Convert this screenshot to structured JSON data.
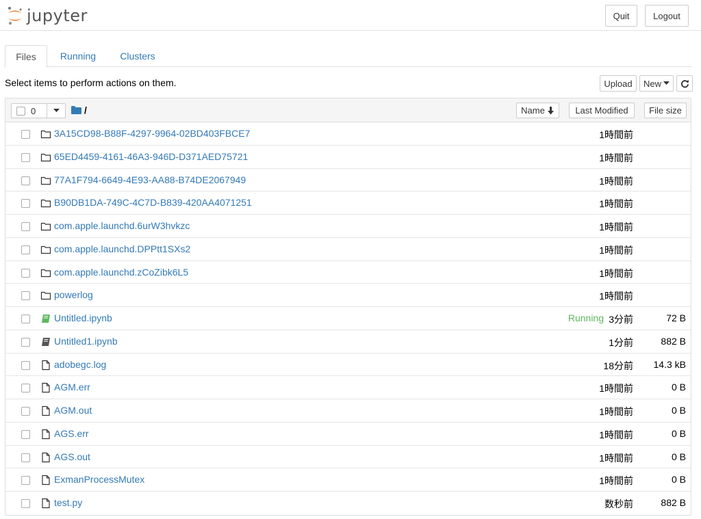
{
  "header": {
    "logo_text": "jupyter",
    "quit_label": "Quit",
    "logout_label": "Logout"
  },
  "tabs": [
    {
      "label": "Files",
      "active": true
    },
    {
      "label": "Running",
      "active": false
    },
    {
      "label": "Clusters",
      "active": false
    }
  ],
  "toolbar": {
    "hint": "Select items to perform actions on them.",
    "upload_label": "Upload",
    "new_label": "New",
    "refresh_icon": "refresh-icon"
  },
  "list_header": {
    "selected_count": "0",
    "breadcrumb": "/",
    "sort_name_label": "Name",
    "sort_modified_label": "Last Modified",
    "sort_size_label": "File size"
  },
  "colors": {
    "link": "#337ab7",
    "running": "#5cb85c",
    "notebook_running": "#5cb85c",
    "folder_icon": "#337ab7",
    "logo_orange": "#f37726"
  },
  "files": [
    {
      "type": "folder",
      "name": "3A15CD98-B88F-4297-9964-02BD403FBCE7",
      "status": "",
      "modified": "1時間前",
      "size": ""
    },
    {
      "type": "folder",
      "name": "65ED4459-4161-46A3-946D-D371AED75721",
      "status": "",
      "modified": "1時間前",
      "size": ""
    },
    {
      "type": "folder",
      "name": "77A1F794-6649-4E93-AA88-B74DE2067949",
      "status": "",
      "modified": "1時間前",
      "size": ""
    },
    {
      "type": "folder",
      "name": "B90DB1DA-749C-4C7D-B839-420AA4071251",
      "status": "",
      "modified": "1時間前",
      "size": ""
    },
    {
      "type": "folder",
      "name": "com.apple.launchd.6urW3hvkzc",
      "status": "",
      "modified": "1時間前",
      "size": ""
    },
    {
      "type": "folder",
      "name": "com.apple.launchd.DPPtt1SXs2",
      "status": "",
      "modified": "1時間前",
      "size": ""
    },
    {
      "type": "folder",
      "name": "com.apple.launchd.zCoZibk6L5",
      "status": "",
      "modified": "1時間前",
      "size": ""
    },
    {
      "type": "folder",
      "name": "powerlog",
      "status": "",
      "modified": "1時間前",
      "size": ""
    },
    {
      "type": "notebook-running",
      "name": "Untitled.ipynb",
      "status": "Running",
      "modified": "3分前",
      "size": "72 B"
    },
    {
      "type": "notebook",
      "name": "Untitled1.ipynb",
      "status": "",
      "modified": "1分前",
      "size": "882 B"
    },
    {
      "type": "file",
      "name": "adobegc.log",
      "status": "",
      "modified": "18分前",
      "size": "14.3 kB"
    },
    {
      "type": "file",
      "name": "AGM.err",
      "status": "",
      "modified": "1時間前",
      "size": "0 B"
    },
    {
      "type": "file",
      "name": "AGM.out",
      "status": "",
      "modified": "1時間前",
      "size": "0 B"
    },
    {
      "type": "file",
      "name": "AGS.err",
      "status": "",
      "modified": "1時間前",
      "size": "0 B"
    },
    {
      "type": "file",
      "name": "AGS.out",
      "status": "",
      "modified": "1時間前",
      "size": "0 B"
    },
    {
      "type": "file",
      "name": "ExmanProcessMutex",
      "status": "",
      "modified": "1時間前",
      "size": "0 B"
    },
    {
      "type": "file",
      "name": "test.py",
      "status": "",
      "modified": "数秒前",
      "size": "882 B"
    }
  ]
}
